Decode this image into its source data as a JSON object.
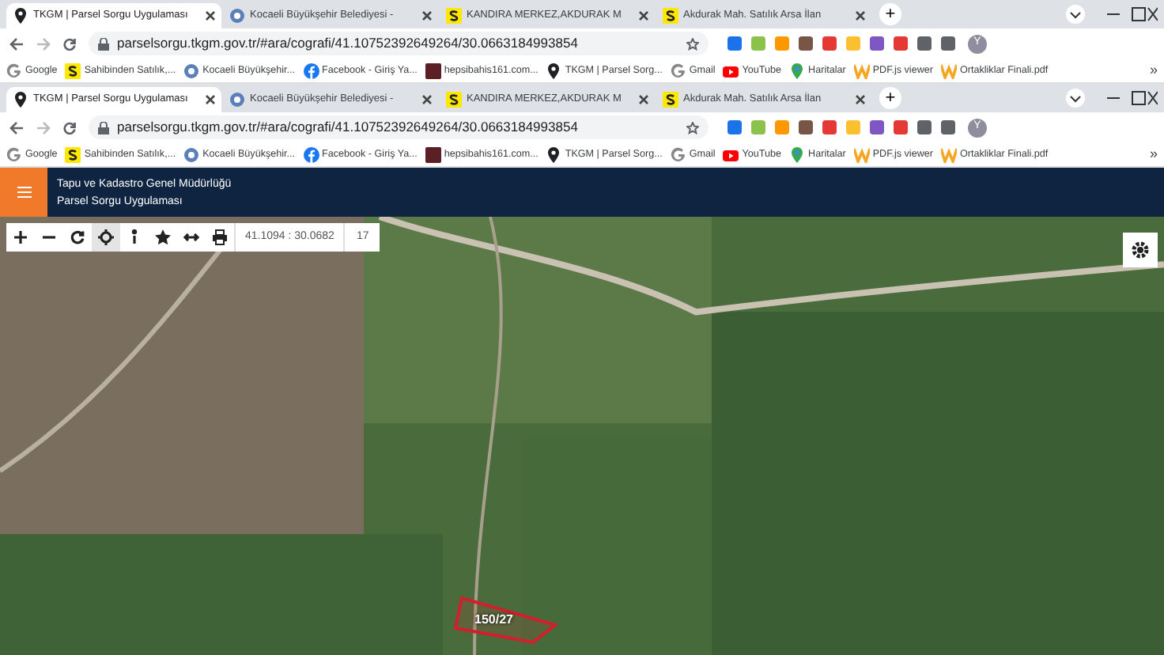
{
  "browser_windows": [
    {
      "tabs": [
        {
          "title": "TKGM | Parsel Sorgu Uygulaması",
          "selected": true
        },
        {
          "title": "Kocaeli Büyükşehir Belediyesi -",
          "selected": false
        },
        {
          "title": "KANDIRA MERKEZ,AKDURAK M",
          "selected": false
        },
        {
          "title": "Akdurak Mah. Satılık Arsa İlan",
          "selected": false
        }
      ],
      "new_tab": "+",
      "address": "parselsorgu.tkgm.gov.tr/#ara/cografi/41.10752392649264/30.0663184993854",
      "avatar_letter": "Y",
      "bookmarks": [
        "Google",
        "Sahibinden Satılık,...",
        "Kocaeli Büyükşehir...",
        "Facebook - Giriş Ya...",
        "hepsibahis161.com...",
        "TKGM | Parsel Sorg...",
        "Gmail",
        "YouTube",
        "Haritalar",
        "PDF.js viewer",
        "Ortakliklar Finali.pdf"
      ],
      "more": "»"
    },
    {
      "tabs": [
        {
          "title": "TKGM | Parsel Sorgu Uygulaması",
          "selected": true
        },
        {
          "title": "Kocaeli Büyükşehir Belediyesi -",
          "selected": false
        },
        {
          "title": "KANDIRA MERKEZ,AKDURAK M",
          "selected": false
        },
        {
          "title": "Akdurak Mah. Satılık Arsa İlan",
          "selected": false
        }
      ],
      "new_tab": "+",
      "address": "parselsorgu.tkgm.gov.tr/#ara/cografi/41.10752392649264/30.0663184993854",
      "avatar_letter": "Y",
      "bookmarks": [
        "Google",
        "Sahibinden Satılık,...",
        "Kocaeli Büyükşehir...",
        "Facebook - Giriş Ya...",
        "hepsibahis161.com...",
        "TKGM | Parsel Sorg...",
        "Gmail",
        "YouTube",
        "Haritalar",
        "PDF.js viewer",
        "Ortakliklar Finali.pdf"
      ],
      "more": "»"
    }
  ],
  "app_header": {
    "title": "Tapu ve Kadastro Genel Müdürlüğü",
    "subtitle": "Parsel Sorgu Uygulaması"
  },
  "map_toolbar": {
    "tools": [
      {
        "kind": "zoom-in",
        "selected": false
      },
      {
        "kind": "zoom-out",
        "selected": false
      },
      {
        "kind": "refresh",
        "selected": false
      },
      {
        "kind": "locate",
        "selected": true
      },
      {
        "kind": "info",
        "selected": false
      },
      {
        "kind": "favorite",
        "selected": false
      },
      {
        "kind": "measure",
        "selected": false
      },
      {
        "kind": "print",
        "selected": false
      }
    ],
    "coordinates": "41.1094 : 30.0682",
    "zoom_level": "17"
  },
  "map": {
    "parcel_label": "150/27"
  }
}
